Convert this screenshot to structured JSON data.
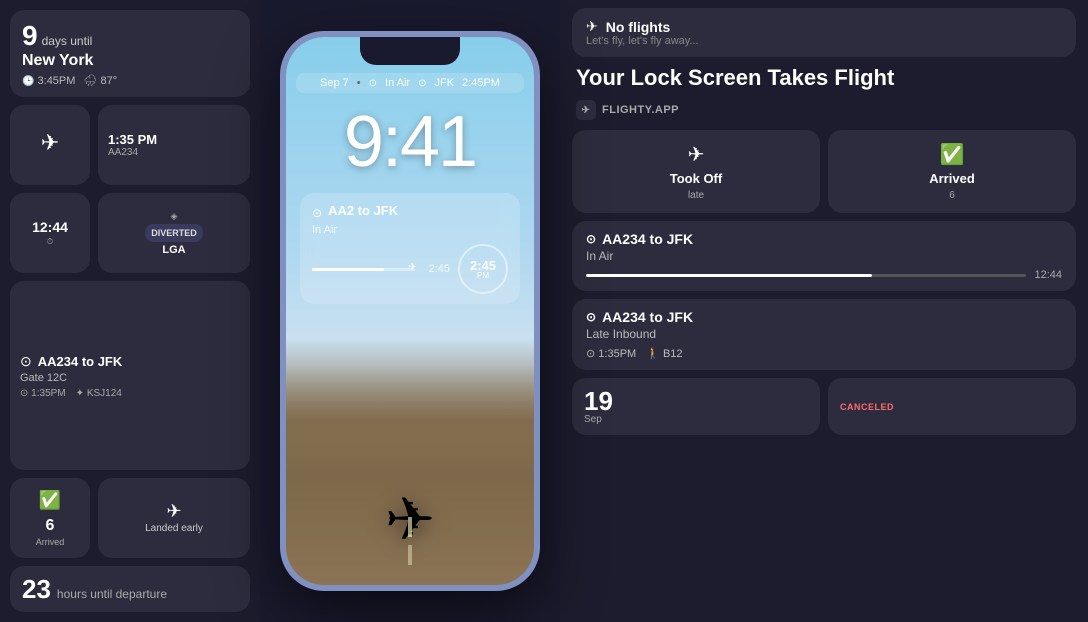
{
  "left": {
    "top_widget": {
      "days": "9",
      "days_label": "days until",
      "city": "New York",
      "time": "3:45PM",
      "weather": "87°"
    },
    "widget_row1": {
      "left": {
        "icon": "✈",
        "type": "airplane-mode"
      },
      "right": {
        "time": "1:35 PM",
        "flight": "AA234"
      }
    },
    "widget_row2": {
      "left": {
        "time": "12:44",
        "type": "clock"
      },
      "right": {
        "status": "DIVERTED",
        "airport": "LGA"
      }
    },
    "gate_widget": {
      "flight": "AA234 to JFK",
      "gate": "Gate 12C",
      "time": "1:35PM",
      "code": "KSJ124"
    },
    "widget_row3": {
      "left": {
        "icon": "✅",
        "num": "6",
        "label": "Arrived"
      },
      "right": {
        "icon": "✈",
        "label": "Landed early"
      }
    },
    "hours_widget": {
      "num": "23",
      "label": "hours until departure"
    }
  },
  "phone": {
    "date": "Sep 7",
    "status": "In Air",
    "destination": "JFK",
    "arrival": "2:45PM",
    "time": "9:41",
    "flight": "AA2 to JFK",
    "flight_status": "In Air",
    "eta": "2:45",
    "eta_unit": "PM",
    "progress": 70
  },
  "right": {
    "header": {
      "app": "Flighty",
      "no_flights": "No flights",
      "tagline": "Let's fly, let's fly away..."
    },
    "title": "Your Lock Screen Takes Flight",
    "app_label": "FLIGHTY.APP",
    "took_off_widget": {
      "icon": "✈",
      "main": "Took Off",
      "sub": "late"
    },
    "arrived_widget": {
      "icon": "✅",
      "main": "Arrived",
      "sub": "6"
    },
    "card1": {
      "flight": "AA234 to JFK",
      "status": "In Air",
      "time": "12:44"
    },
    "card2": {
      "flight": "AA234 to JFK",
      "status": "Late Inbound",
      "time": "1:35PM",
      "gate": "B12"
    },
    "bottom_left": {
      "num": "19",
      "month": "Sep"
    },
    "bottom_right": {
      "label": "CANCELED"
    }
  }
}
